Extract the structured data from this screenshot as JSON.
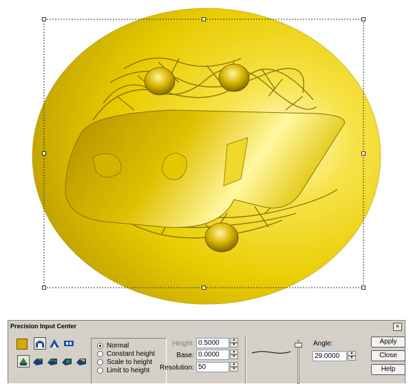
{
  "panel": {
    "title": "Precision Input Center",
    "close_label": "×",
    "modes": [
      "Normal",
      "Constant height",
      "Scale to height",
      "Limit to height"
    ],
    "fields": {
      "height": {
        "label": "Height:",
        "value": "0.5000"
      },
      "base": {
        "label": "Base:",
        "value": "0.0000"
      },
      "resolution": {
        "label": "Resolution:",
        "value": "50"
      },
      "angle": {
        "label": "Angle:",
        "value": "29.0000"
      }
    },
    "buttons": {
      "apply": "Apply",
      "close": "Close",
      "help": "Help"
    }
  },
  "colors": {
    "accent_gold": "#f2d21a",
    "panel_bg": "#d4d0c8"
  }
}
